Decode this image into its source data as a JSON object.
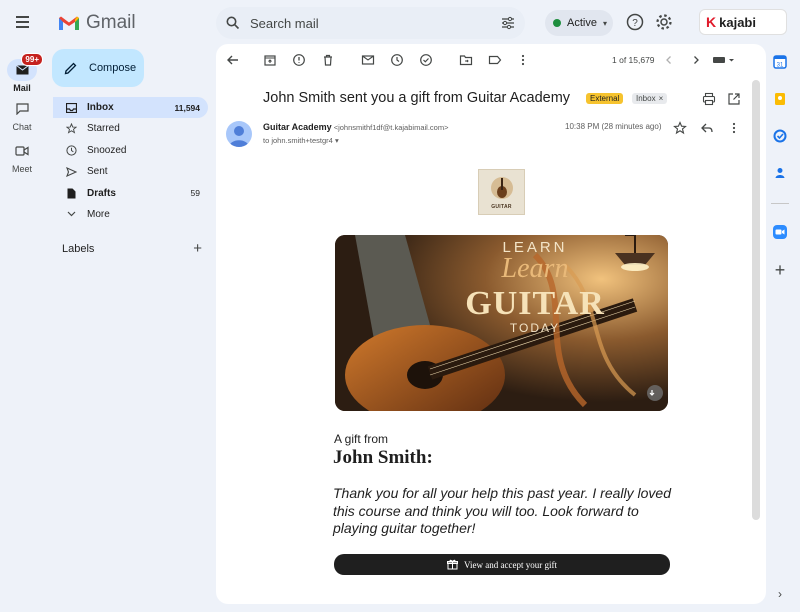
{
  "app": {
    "name": "Gmail",
    "brand_color": "#ea4335"
  },
  "search": {
    "placeholder": "Search mail"
  },
  "status": {
    "label": "Active"
  },
  "account": {
    "brand": "kajabi"
  },
  "rail": {
    "mail": {
      "label": "Mail",
      "badge": "99+"
    },
    "chat": {
      "label": "Chat"
    },
    "meet": {
      "label": "Meet"
    }
  },
  "compose": {
    "label": "Compose"
  },
  "nav": [
    {
      "label": "Inbox",
      "count": "11,594",
      "icon": "inbox-icon"
    },
    {
      "label": "Starred",
      "count": "",
      "icon": "star-icon"
    },
    {
      "label": "Snoozed",
      "count": "",
      "icon": "clock-icon"
    },
    {
      "label": "Sent",
      "count": "",
      "icon": "send-icon"
    },
    {
      "label": "Drafts",
      "count": "59",
      "icon": "draft-icon"
    },
    {
      "label": "More",
      "count": "",
      "icon": "chevron-down-icon"
    }
  ],
  "labels": {
    "title": "Labels"
  },
  "pager": {
    "text": "1 of 15,679"
  },
  "email": {
    "subject": "John Smith sent you a gift from Guitar Academy",
    "tag_external": "External",
    "tag_inbox": "Inbox",
    "sender_name": "Guitar Academy",
    "sender_email": "<johnsmithf1df@t.kajabimail.com>",
    "to": "to john.smith+testgr4",
    "time": "10:38 PM (28 minutes ago)",
    "logo_text": "GUITAR",
    "hero": {
      "line1": "LEARN",
      "line2": "Learn",
      "line3": "GUITAR",
      "line4": "TODAY"
    },
    "gift_from": "A gift from",
    "gift_name": "John Smith:",
    "message": "Thank you for all your help this past year. I really loved this course and think you will too. Look forward to playing guitar together!",
    "cta": "View and accept your gift"
  }
}
